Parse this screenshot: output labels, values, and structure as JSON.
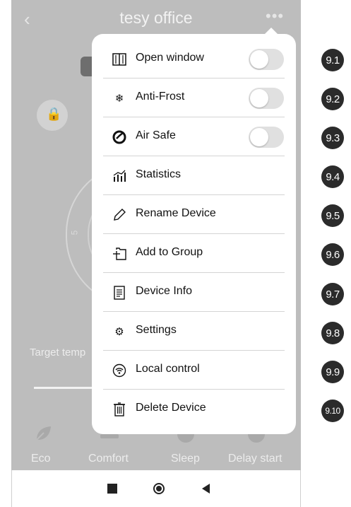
{
  "header": {
    "title": "tesy office",
    "back_icon": "chevron-left-icon",
    "more_icon": "more-dots-icon"
  },
  "background": {
    "lock_icon": "lock-icon",
    "dial_number": "5",
    "target_label": "Target temp",
    "modes": [
      {
        "label": "Eco",
        "icon": "leaf-icon"
      },
      {
        "label": "Comfort",
        "icon": "sofa-icon"
      },
      {
        "label": "Sleep",
        "icon": "moon-icon"
      },
      {
        "label": "Delay start",
        "icon": "clock-icon"
      }
    ]
  },
  "menu": {
    "items": [
      {
        "label": "Open window",
        "icon": "window-icon",
        "toggle": true,
        "toggle_on": false
      },
      {
        "label": "Anti-Frost",
        "icon": "snowflake-icon",
        "toggle": true,
        "toggle_on": false
      },
      {
        "label": "Air Safe",
        "icon": "air-safe-icon",
        "toggle": true,
        "toggle_on": false
      },
      {
        "label": "Statistics",
        "icon": "statistics-icon",
        "toggle": false
      },
      {
        "label": "Rename Device",
        "icon": "pencil-icon",
        "toggle": false
      },
      {
        "label": "Add to Group",
        "icon": "add-group-icon",
        "toggle": false
      },
      {
        "label": "Device Info",
        "icon": "document-icon",
        "toggle": false
      },
      {
        "label": "Settings",
        "icon": "gear-icon",
        "toggle": false
      },
      {
        "label": "Local control",
        "icon": "wifi-circle-icon",
        "toggle": false
      },
      {
        "label": "Delete Device",
        "icon": "trash-icon",
        "toggle": false
      }
    ]
  },
  "badges": [
    "9.1",
    "9.2",
    "9.3",
    "9.4",
    "9.5",
    "9.6",
    "9.7",
    "9.8",
    "9.9",
    "9.10"
  ],
  "nav": {
    "recents_icon": "square-icon",
    "home_icon": "circle-icon",
    "back_icon": "triangle-back-icon"
  }
}
